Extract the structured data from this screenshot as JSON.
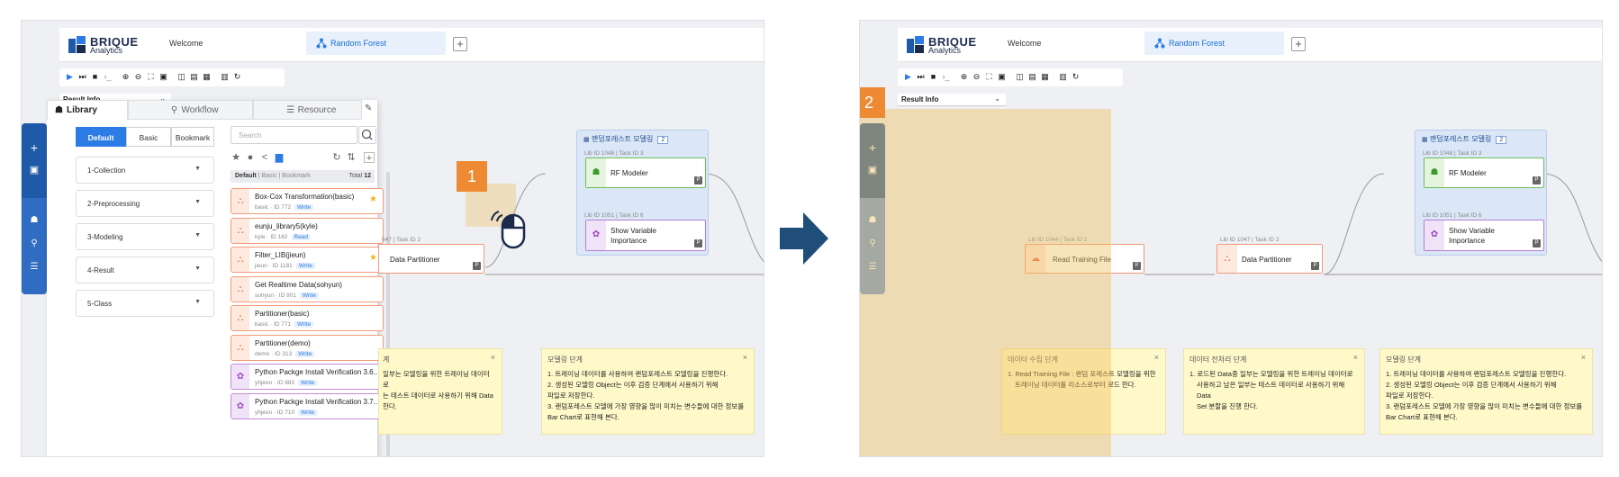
{
  "app": {
    "logo_main": "BRIQUE",
    "logo_sub": "Analytics",
    "tabs": [
      {
        "label": "Welcome"
      },
      {
        "label": "Random Forest"
      }
    ],
    "add_tab": "+",
    "result_info": "Result Info"
  },
  "library": {
    "tabs": [
      "Library",
      "Workflow",
      "Resource"
    ],
    "segments": [
      "Default",
      "Basic",
      "Bookmark"
    ],
    "categories": [
      "1-Collection",
      "2-Preprocessing",
      "3-Modeling",
      "4-Result",
      "5-Class"
    ],
    "search_placeholder": "Search",
    "list_header": {
      "default": "Default",
      "rest": "| Basic | Bookmark",
      "total_label": "Total",
      "total": "12"
    },
    "items": [
      {
        "name": "Box-Cox Transformation(basic)",
        "meta": "basic · ID 772",
        "badge": "Write",
        "star": true,
        "color": "orange"
      },
      {
        "name": "eunju_library5(kyle)",
        "meta": "kyle · ID 162",
        "badge": "Read",
        "star": false,
        "color": "orange"
      },
      {
        "name": "Filter_LIB(jieun)",
        "meta": "jieun · ID 1181",
        "badge": "Write",
        "star": true,
        "color": "orange"
      },
      {
        "name": "Get Realtime Data(sohyun)",
        "meta": "sohyun · ID 901",
        "badge": "Write",
        "star": false,
        "color": "orange"
      },
      {
        "name": "Partitioner(basic)",
        "meta": "basic · ID 771",
        "badge": "Write",
        "star": false,
        "color": "orange"
      },
      {
        "name": "Partitioner(demo)",
        "meta": "demo · ID 313",
        "badge": "Write",
        "star": false,
        "color": "orange"
      },
      {
        "name": "Python Packge Install Verification 3.6...",
        "meta": "yhjeon · ID 882",
        "badge": "Write",
        "star": false,
        "color": "purple"
      },
      {
        "name": "Python Packge Install Verification 3.7...",
        "meta": "yhjeon · ID 710",
        "badge": "Write",
        "star": false,
        "color": "purple"
      }
    ]
  },
  "workflow": {
    "group_title": "랜덤포레스트 모델링",
    "group_count": "2",
    "rf_libid": "Lib ID 1048 | Task ID 3",
    "rf_label": "RF Modeler",
    "svi_libid": "Lib ID 1051 | Task ID 6",
    "svi_label": [
      "Show Variable",
      "Importance"
    ],
    "dp_libid": "Lib ID 1047 | Task ID 2",
    "dp_label": "Data Partitioner",
    "rtf_libid": "Lib ID 1044 | Task ID 1",
    "rtf_label": "Read Training File",
    "p_badge": "P"
  },
  "notes": {
    "collect": {
      "title": "데이터 수집 단계",
      "body": [
        "1. Read Training File : 랜덤 포레스트 모델링을 위한",
        "트레이닝 데이터를 리소스로부터 로드 한다."
      ]
    },
    "preprocess": {
      "title": "데이터 전처리 단계",
      "body": [
        "1. 로드된 Data중 일부는 모델링을 위한 트레이닝 데이터로",
        "사용하고 남은 일부는 테스트 데이터로 사용하기 위해 Data",
        "Set 분할을 진행 한다."
      ]
    },
    "preprocess_left_partial": {
      "title": "계",
      "body": [
        "일부는 모델링을 위한 트레이닝 데이터로",
        "는 테스트 데이터로 사용하기 위해 Data",
        "한다."
      ]
    },
    "modeling": {
      "title": "모델링 단계",
      "body": [
        "1. 트레이닝 데이터를 사용하여 랜덤포레스트 모델링을 진행한다.",
        "2. 생성된 모델링 Object는 이후 검증 단계에서 사용하기 위해",
        "파일로 저장한다.",
        "3. 랜덤포레스트 모델에 가장 영향을 많이 미치는 변수들에 대한 정보를",
        "Bar Chart로 표현해 본다."
      ]
    },
    "close": "×"
  },
  "callouts": {
    "one": "1",
    "two": "2"
  },
  "colors": {
    "primary": "#2d7be5",
    "sidebar_dark": "#1f5aa8",
    "callout": "#ee8a33",
    "arrow": "#1f4e79",
    "highlight": "rgba(238,190,90,0.42)"
  }
}
